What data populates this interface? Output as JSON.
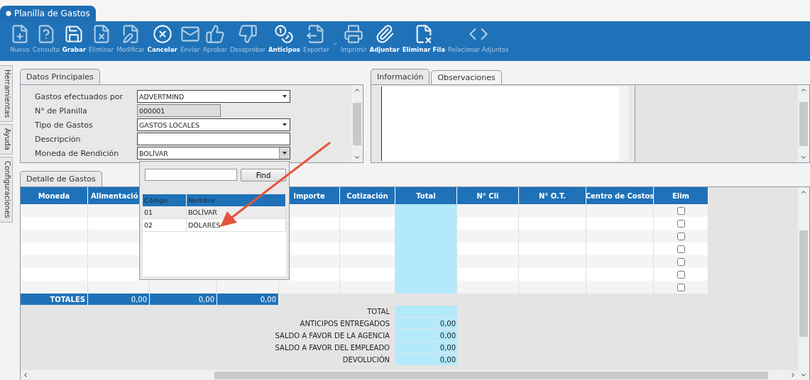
{
  "window": {
    "tab": "Planilla de Gastos"
  },
  "toolbar": [
    {
      "label": "Nuevo",
      "disabled": true
    },
    {
      "label": "Consulta",
      "disabled": true
    },
    {
      "label": "Grabar",
      "disabled": false
    },
    {
      "label": "Eliminar",
      "disabled": true
    },
    {
      "label": "Modificar",
      "disabled": true
    },
    {
      "label": "Cancelar",
      "disabled": false
    },
    {
      "label": "Enviar",
      "disabled": true
    },
    {
      "label": "Aprobar",
      "disabled": true
    },
    {
      "label": "Desaprobar",
      "disabled": true
    },
    {
      "label": "Anticipos",
      "disabled": false
    },
    {
      "label": "Exportar",
      "disabled": true
    },
    {
      "label": "Imprimir",
      "disabled": true
    },
    {
      "label": "Adjuntar",
      "disabled": false
    },
    {
      "label": "Eliminar Fila",
      "disabled": false
    },
    {
      "label": "Relacionar Adjuntos",
      "disabled": true
    }
  ],
  "side_tabs": [
    "Herramientas",
    "Ayuda",
    "Configuraciones"
  ],
  "main_panel": {
    "tab": "Datos Principales",
    "fields": [
      {
        "label": "Gastos efectuados por",
        "kind": "dropdown",
        "value": "ADVERTMIND"
      },
      {
        "label": "N° de Planilla",
        "kind": "readonly",
        "value": "000001"
      },
      {
        "label": "Tipo de Gastos",
        "kind": "dropdown",
        "value": "GASTOS LOCALES"
      },
      {
        "label": "Descripción",
        "kind": "text"
      },
      {
        "label": "Moneda de Rendición",
        "kind": "dropdown",
        "value": "BOLÍVAR",
        "open": true
      }
    ]
  },
  "info_panel": {
    "tabs": [
      {
        "label": "Información",
        "selected": true
      },
      {
        "label": "Observaciones",
        "selected": false
      }
    ]
  },
  "dropdown_popup": {
    "button": "Find",
    "columns": [
      "Código",
      "Nombre"
    ],
    "rows": [
      {
        "code": "01",
        "name": "BOLÍVAR",
        "selected": true
      },
      {
        "code": "02",
        "name": "DÓLARES",
        "selected": false
      }
    ]
  },
  "detail": {
    "tab": "Detalle de Gastos",
    "columns": [
      {
        "label": "Moneda"
      },
      {
        "label": "Alimentació"
      },
      {},
      {},
      {
        "label": "Importe"
      },
      {
        "label": "Cotización"
      },
      {
        "label": "Total"
      },
      {
        "label": "N° Cli"
      },
      {
        "label": "N° O.T."
      },
      {
        "label": "Centro de Costos"
      },
      {
        "label": "Elim"
      }
    ],
    "rows": [
      {
        "checked": false
      },
      {
        "checked": false
      },
      {
        "checked": false
      },
      {
        "checked": false
      },
      {
        "checked": false
      },
      {
        "checked": false
      },
      {
        "checked": false
      }
    ],
    "totals": [
      "TOTALES",
      "0,00",
      "0,00",
      "0,00"
    ],
    "summary": [
      {
        "label": "TOTAL"
      },
      {
        "label": "ANTICIPOS ENTREGADOS",
        "value": "0,00"
      },
      {
        "label": "SALDO A FAVOR DE LA AGENCIA",
        "value": "0,00"
      },
      {
        "label": "SALDO A FAVOR DEL EMPLEADO",
        "value": "0,00"
      },
      {
        "label": "DEVOLUCIÓN",
        "value": "0,00"
      }
    ]
  }
}
